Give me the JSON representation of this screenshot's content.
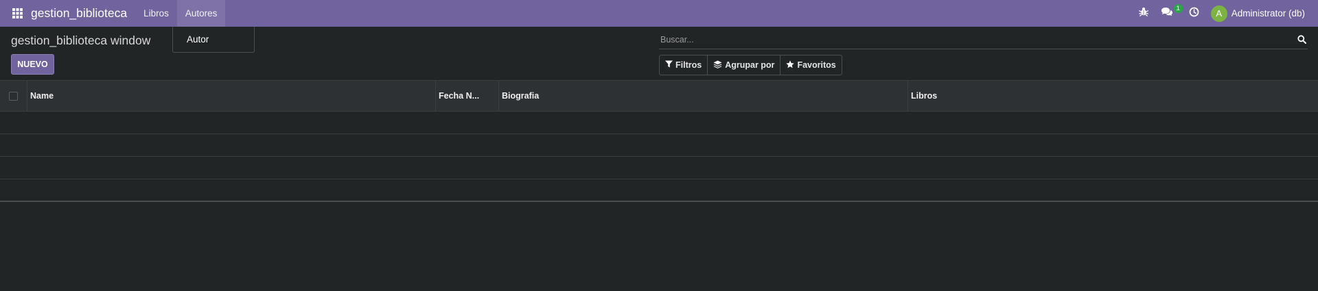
{
  "navbar": {
    "icons": {
      "apps": "apps-grid-icon",
      "debug": "bug-icon",
      "messages": "chat-icon",
      "activity": "clock-icon"
    },
    "brand": "gestion_biblioteca",
    "menu": [
      {
        "label": "Libros"
      },
      {
        "label": "Autores"
      }
    ],
    "messages_badge": "1",
    "user": {
      "initial": "A",
      "name": "Administrator (db)"
    }
  },
  "dropdown": {
    "items": [
      {
        "label": "Autor"
      }
    ]
  },
  "control_panel": {
    "breadcrumb": "gestion_biblioteca window",
    "new_button": "NUEVO",
    "search": {
      "placeholder": "Buscar...",
      "value": ""
    },
    "filters": {
      "filters": "Filtros",
      "group_by": "Agrupar por",
      "favorites": "Favoritos"
    }
  },
  "table": {
    "columns": [
      {
        "label": "Name"
      },
      {
        "label": "Fecha N..."
      },
      {
        "label": "Biografia"
      },
      {
        "label": "Libros"
      }
    ],
    "rows": []
  },
  "colors": {
    "navbar": "#71639e",
    "background": "#212526",
    "header": "#2d3134",
    "badge": "#28a745",
    "avatar": "#7cb342"
  }
}
